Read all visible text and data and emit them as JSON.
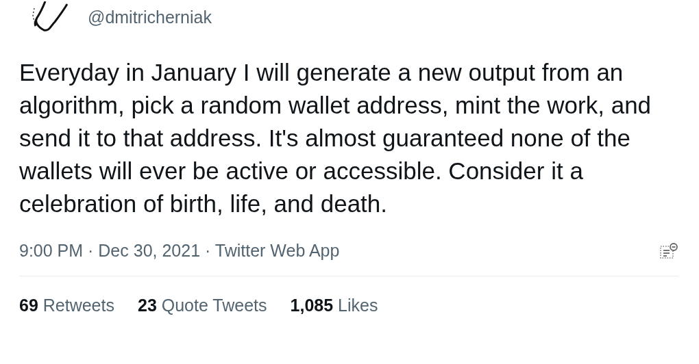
{
  "author": {
    "handle": "@dmitricherniak"
  },
  "tweet": {
    "text": "Everyday in January I will generate a new output from an algorithm, pick a random wallet address, mint the work, and send it to that address. It's almost guaranteed none of the wallets will ever be active or accessible. Consider it a celebration of birth, life, and death.",
    "meta": "9:00 PM · Dec 30, 2021 · Twitter Web App"
  },
  "stats": [
    {
      "count": "69",
      "label": "Retweets"
    },
    {
      "count": "23",
      "label": "Quote Tweets"
    },
    {
      "count": "1,085",
      "label": "Likes"
    }
  ]
}
